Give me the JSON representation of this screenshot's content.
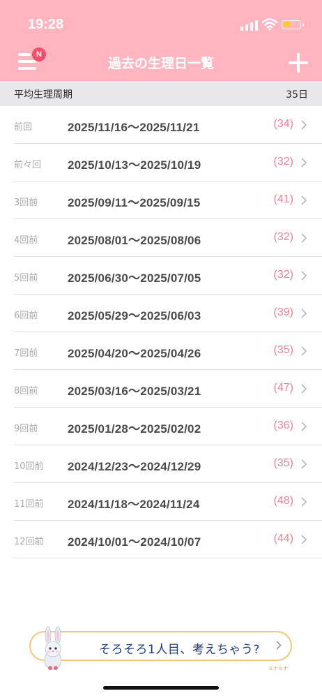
{
  "status_bar": {
    "time": "19:28",
    "icons": [
      "signal-icon",
      "wifi-icon",
      "battery-icon"
    ],
    "battery_level": 0.25
  },
  "header": {
    "title": "過去の生理日一覧",
    "notification_badge": "N",
    "colors": {
      "background": "#FFB5C0",
      "badge": "#F2506A"
    }
  },
  "summary": {
    "label": "平均生理周期",
    "value": "35日"
  },
  "periods": [
    {
      "ordinal": "前回",
      "range": "2025/11/16～2025/11/21",
      "days": "(34)"
    },
    {
      "ordinal": "前々回",
      "range": "2025/10/13～2025/10/19",
      "days": "(32)"
    },
    {
      "ordinal": "3回前",
      "range": "2025/09/11～2025/09/15",
      "days": "(41)"
    },
    {
      "ordinal": "4回前",
      "range": "2025/08/01～2025/08/06",
      "days": "(32)"
    },
    {
      "ordinal": "5回前",
      "range": "2025/06/30～2025/07/05",
      "days": "(32)"
    },
    {
      "ordinal": "6回前",
      "range": "2025/05/29～2025/06/03",
      "days": "(39)"
    },
    {
      "ordinal": "7回前",
      "range": "2025/04/20～2025/04/26",
      "days": "(35)"
    },
    {
      "ordinal": "8回前",
      "range": "2025/03/16～2025/03/21",
      "days": "(47)"
    },
    {
      "ordinal": "9回前",
      "range": "2025/01/28～2025/02/02",
      "days": "(36)"
    },
    {
      "ordinal": "10回前",
      "range": "2024/12/23～2024/12/29",
      "days": "(35)"
    },
    {
      "ordinal": "11回前",
      "range": "2024/11/18～2024/11/24",
      "days": "(48)"
    },
    {
      "ordinal": "12回前",
      "range": "2024/10/01～2024/10/07",
      "days": "(44)"
    }
  ],
  "banner": {
    "text": "そろそろ1人目、考えちゃう?",
    "brand": "ルナルナ"
  }
}
